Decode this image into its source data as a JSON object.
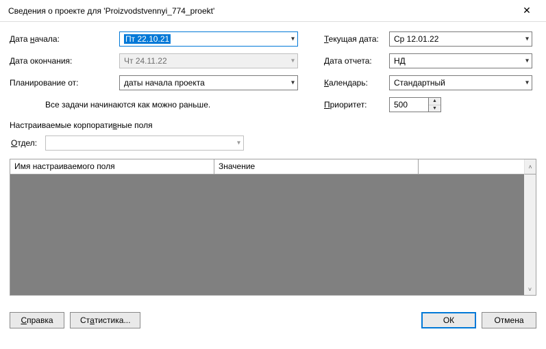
{
  "title": "Сведения о проекте для 'Proizvodstvennyi_774_proekt'",
  "labels": {
    "start_date_pre": "Дата",
    "start_date_accel": "н",
    "start_date_post": "ачала:",
    "end_date": "Дата окончания:",
    "schedule_from": "Планирование от:",
    "help_text": "Все задачи начинаются как можно раньше.",
    "current_date_pre": "",
    "current_date_accel": "Т",
    "current_date_post": "екущая дата:",
    "report_date": "Дата отчета:",
    "calendar_pre": "",
    "calendar_accel": "К",
    "calendar_post": "алендарь:",
    "priority_pre": "",
    "priority_accel": "П",
    "priority_post": "риоритет:",
    "custom_fields_pre": "Настраиваемые корпорати",
    "custom_fields_accel": "в",
    "custom_fields_post": "ные поля",
    "dept_pre": "",
    "dept_accel": "О",
    "dept_post": "тдел:",
    "col1": "Имя настраиваемого поля",
    "col2": "Значение"
  },
  "values": {
    "start_date": "Пт 22.10.21",
    "end_date": "Чт 24.11.22",
    "schedule_from": "даты начала проекта",
    "current_date": "Ср 12.01.22",
    "report_date": "НД",
    "calendar": "Стандартный",
    "priority": "500",
    "dept": ""
  },
  "buttons": {
    "help_pre": "",
    "help_accel": "С",
    "help_post": "правка",
    "stats_pre": "Ст",
    "stats_accel": "а",
    "stats_post": "тистика...",
    "ok": "ОК",
    "cancel": "Отмена"
  }
}
